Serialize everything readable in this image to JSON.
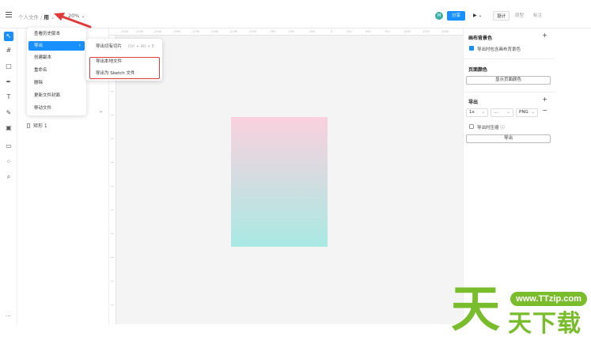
{
  "topbar": {
    "breadcrumb_parent": "个人文件 /",
    "breadcrumb_current": "用",
    "zoom": "20%",
    "avatar": "M",
    "share_label": "分享",
    "play_label": "▶ ⌄",
    "tabs": [
      "设计",
      "原型",
      "标注"
    ],
    "active_tab": "设计"
  },
  "file_menu": {
    "items": [
      "查看历史版本",
      "导出",
      "创建副本",
      "重命名",
      "删除",
      "更新文件封面",
      "移动文件"
    ],
    "active_item": "导出"
  },
  "export_submenu": {
    "items": [
      {
        "label": "导出切有切片",
        "shortcut": "Ctrl + Alt + E"
      },
      {
        "label": "导出本地文件",
        "shortcut": ""
      },
      {
        "label": "导出为 Sketch 文件",
        "shortcut": ""
      }
    ]
  },
  "layers": {
    "items": [
      "矩形 1"
    ]
  },
  "ruler": {
    "labels": [
      "-2540",
      "-2540",
      "-2540",
      "-1990",
      "-1790",
      "-1580",
      "-1290",
      "-1050",
      "-780",
      "-590",
      "-390",
      "0",
      "250",
      "490",
      "750",
      "1000",
      "1250",
      "1580"
    ]
  },
  "artboard": {
    "gradient_top": "#fad1de",
    "gradient_bottom": "#a9e9e3"
  },
  "right_panel": {
    "canvas_bg_title": "画布背景色",
    "canvas_bg_option": "导出时包含画布背景色",
    "page_color_title": "页面颜色",
    "page_color_button": "显示页面颜色",
    "export_title": "导出",
    "export_scale": "1x",
    "export_suffix": "...",
    "export_format": "PNG",
    "export_compress": "导出时压缩",
    "export_button": "导出"
  },
  "watermark": {
    "url": "www.TTzip.com",
    "big": "天",
    "small": "天下载"
  },
  "colors": {
    "accent": "#1890ff",
    "highlight_box": "#e03a3a",
    "watermark": "#79bc2c"
  }
}
